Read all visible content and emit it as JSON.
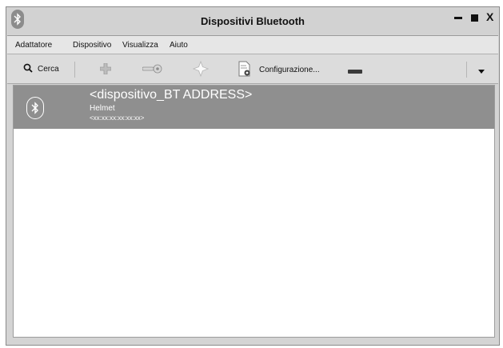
{
  "window": {
    "title": "Dispositivi Bluetooth",
    "controls": {
      "minimize_icon": "minimize-icon",
      "maximize_icon": "maximize-icon",
      "close_label": "X"
    }
  },
  "menubar": {
    "items": [
      "Adattatore",
      "Dispositivo",
      "Visualizza",
      "Aiuto"
    ]
  },
  "toolbar": {
    "search_label": "Cerca",
    "setup_label": "Configurazione...",
    "icons": [
      "search-icon",
      "add-device-icon",
      "key-icon",
      "trust-star-icon",
      "setup-document-icon",
      "remove-bar-icon",
      "chevron-down-icon"
    ]
  },
  "devices": [
    {
      "name": "<dispositivo_BT ADDRESS>",
      "type": "Helmet",
      "address": "<xx:xx:xx:xx:xx:xx>",
      "icon": "bluetooth-icon"
    }
  ],
  "colors": {
    "selected_row": "#8f8f8f",
    "window_bg": "#d4d4d4",
    "content_bg": "#ffffff"
  }
}
